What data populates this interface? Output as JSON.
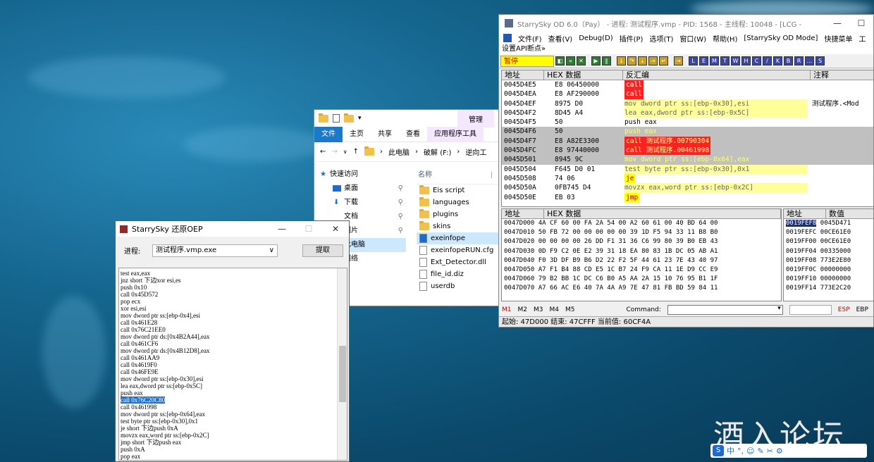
{
  "explorer": {
    "ribbon_tabs": [
      "文件",
      "主页",
      "共享",
      "查看",
      "应用程序工具"
    ],
    "manage_tab": "管理",
    "breadcrumb": [
      "此电脑",
      "破解 (F:)",
      "逆向工"
    ],
    "nav": [
      "快速访问",
      "桌面",
      "下载",
      "文档",
      "图片",
      "此电脑",
      "网络"
    ],
    "column_name": "名称",
    "files": [
      "Eis script",
      "languages",
      "plugins",
      "skins",
      "exeinfope",
      "exeinfopeRUN.cfg",
      "Ext_Detector.dll",
      "file_id.diz",
      "userdb"
    ]
  },
  "oep": {
    "title": "StarrySky 还原OEP",
    "process_label": "进程:",
    "process_value": "测试程序.vmp.exe",
    "extract_button": "提取",
    "code": [
      "test eax,eax",
      "jnz short 下边xor esi,es",
      "push 0x10",
      "call 0x45D572",
      "pop ecx",
      "xor esi,esi",
      "mov dword ptr ss:[ebp-0x4],esi",
      "call 0x461E28",
      "call 0x76C21EE0",
      "mov dword ptr ds:[0x4B2A44],eax",
      "call 0x461CF6",
      "mov dword ptr ds:[0x4B12D8],eax",
      "call 0x461AA9",
      "call 0x4619F0",
      "call 0x46FE9E",
      "mov dword ptr ss:[ebp-0x30],esi",
      "lea eax,dword ptr ss:[ebp-0x5C]",
      "push eax",
      "call 0x76C20C80",
      "call 0x461998",
      "mov dword ptr ss:[ebp-0x64],eax",
      "test byte ptr ss:[ebp-0x30],0x1",
      "je short 下边push 0xA",
      "movzx eax,word ptr ss:[ebp-0x2C]",
      "jmp short 下边push eax",
      "push 0xA",
      "pop eax"
    ],
    "highlight_index": 18
  },
  "od": {
    "title": "StarrySky OD 6.0（Pay） - 进程: 测试程序.vmp - PID: 1568 - 主线程: 10048 - [LCG -",
    "menu": [
      "文件(F)",
      "查看(V)",
      "Debug(D)",
      "插件(P)",
      "选项(T)",
      "窗口(W)",
      "帮助(H)",
      "[StarrySky OD Mode]",
      "快捷菜单",
      "工"
    ],
    "submenu": "设置API断点»",
    "pause": "暂停",
    "toolbar_letters": [
      "L",
      "E",
      "M",
      "T",
      "W",
      "H",
      "C",
      "/",
      "K",
      "B",
      "R",
      "...",
      "S"
    ],
    "disasm_headers": [
      "地址",
      "HEX 数据",
      "反汇编",
      "注释"
    ],
    "disasm": [
      {
        "addr": "0045D4E5",
        "hex": "E8 06450000",
        "asm": "call",
        "style": "red"
      },
      {
        "addr": "0045D4EA",
        "hex": "E8 AF290000",
        "asm": "call",
        "style": "red"
      },
      {
        "addr": "0045D4EF",
        "hex": "8975 D0",
        "asm": "mov dword ptr ss:[ebp-0x30],esi",
        "style": "yel",
        "cmt": "测试程序.<Mod"
      },
      {
        "addr": "0045D4F2",
        "hex": "8D45 A4",
        "asm": "lea eax,dword ptr ss:[ebp-0x5C]",
        "style": "yel"
      },
      {
        "addr": "0045D4F5",
        "hex": "50",
        "asm": "push eax",
        "style": "plain"
      },
      {
        "addr": "0045D4F6",
        "hex": "50",
        "asm": "push eax",
        "style": "gray"
      },
      {
        "addr": "0045D4F7",
        "hex": "E8 A82E3300",
        "asm": "call 测试程序.00790304",
        "style": "grayred"
      },
      {
        "addr": "0045D4FC",
        "hex": "E8 97440000",
        "asm": "call 测试程序.00461998",
        "style": "grayred"
      },
      {
        "addr": "0045D501",
        "hex": "8945 9C",
        "asm": "mov dword ptr ss:[ebp-0x64],eax",
        "style": "gray"
      },
      {
        "addr": "0045D504",
        "hex": "F645 D0 01",
        "asm": "test byte ptr ss:[ebp-0x30],0x1",
        "style": "yel"
      },
      {
        "addr": "0045D508",
        "hex": "74 06",
        "asm": "je",
        "style": "jmp"
      },
      {
        "addr": "0045D50A",
        "hex": "0FB745 D4",
        "asm": "movzx eax,word ptr ss:[ebp-0x2C]",
        "style": "yel"
      },
      {
        "addr": "0045D50E",
        "hex": "EB 03",
        "asm": "jmp",
        "style": "jmp"
      }
    ],
    "dump_headers": [
      "地址",
      "HEX 数据"
    ],
    "dump": [
      "0047D000 4A CF 60 00 FA 2A 54 00 A2 60 61 00 40 BD 64 00",
      "0047D010 50 FB 72 00 00 00 00 00 39 1D F5 94 33 11 B8 B0",
      "0047D020 00 00 00 00 26 DD F1 31 36 C6 99 80 39 B0 EB 43",
      "0047D030 0D F9 C2 0E E2 39 31 18 EA 80 83 1B DC 05 AB A1",
      "0047D040 F0 3D DF B9 B6 D2 22 F2 5F 44 61 23 7E 43 40 97",
      "0047D050 A7 F1 B4 88 CD E5 1C B7 24 F9 CA 11 1E D9 CC E9",
      "0047D060 79 B2 BB 1C DC C6 B0 A5 AA 2A 15 10 76 95 B1 1F",
      "0047D070 A7 66 AC E6 40 7A 4A A9 7E 47 81 FB BD 59 84 11"
    ],
    "stack_headers": [
      "地址",
      "数值"
    ],
    "stack": [
      {
        "addr": "0019FEF8",
        "val": "0045D471",
        "sel": true
      },
      {
        "addr": "0019FEFC",
        "val": "00CE61E0"
      },
      {
        "addr": "0019FF00",
        "val": "00CE61E0"
      },
      {
        "addr": "0019FF04",
        "val": "00335000"
      },
      {
        "addr": "0019FF08",
        "val": "773E2E80"
      },
      {
        "addr": "0019FF0C",
        "val": "00000000"
      },
      {
        "addr": "0019FF10",
        "val": "00000000"
      },
      {
        "addr": "0019FF14",
        "val": "773E2C20"
      }
    ],
    "marks": [
      "M1",
      "M2",
      "M3",
      "M4",
      "M5"
    ],
    "command_label": "Command:",
    "regs": [
      "ESP",
      "EBP"
    ],
    "status": "起始: 47D000  结束: 47CFFF  当前值: 60CF4A"
  },
  "watermark": "酒入论坛",
  "ime": [
    "中",
    "°,",
    "☺",
    "✎",
    "✂",
    "⚙"
  ]
}
